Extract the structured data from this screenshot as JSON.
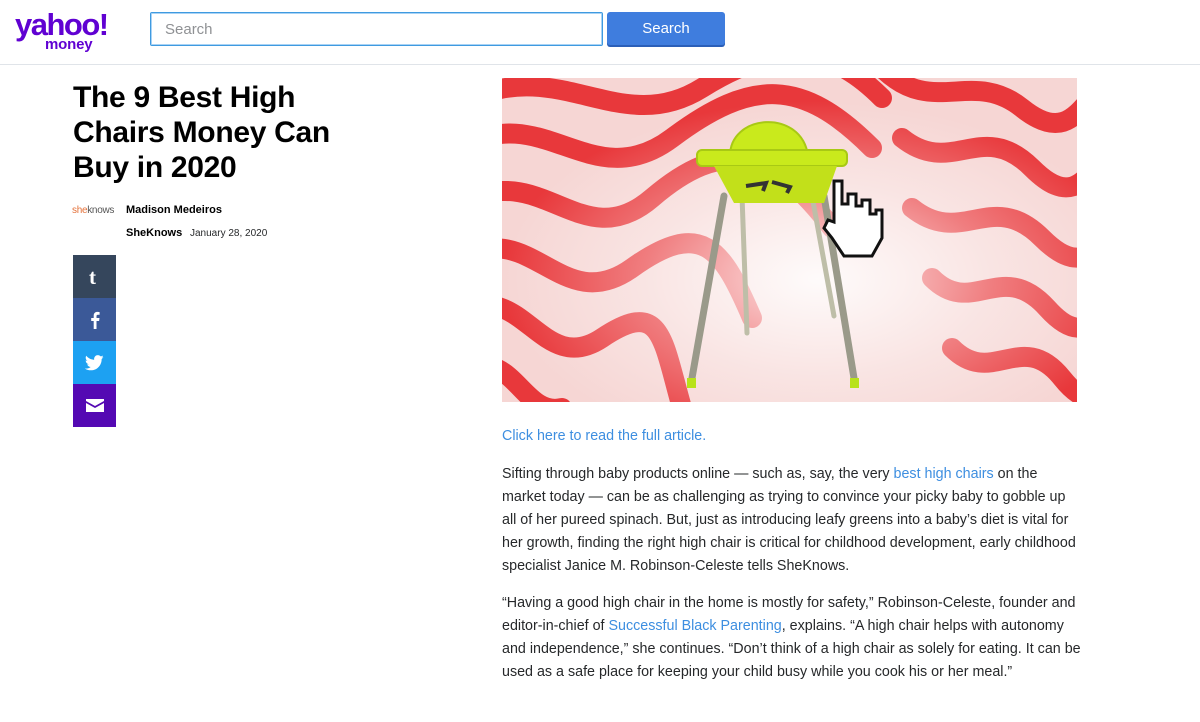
{
  "header": {
    "logo_primary": "yahoo!",
    "logo_secondary": "money",
    "search_placeholder": "Search",
    "search_value": "",
    "search_button": "Search",
    "brand_color": "#6001d2",
    "accent_color": "#3f7dde"
  },
  "article": {
    "title": "The 9 Best High Chairs Money Can Buy in 2020",
    "source_logo_a": "she",
    "source_logo_b": "knows",
    "author": "Madison Medeiros",
    "provider": "SheKnows",
    "date": "January 28, 2020",
    "read_full_link": "Click here to read the full article.",
    "p1_before": "Sifting through baby products online — such as, say, the very ",
    "p1_link": "best high chairs",
    "p1_after": " on the market today — can be as challenging as trying to convince your picky baby to gobble up all of her pureed spinach. But, just as introducing leafy greens into a baby’s diet is vital for her growth, finding the right high chair is critical for childhood development, early childhood specialist Janice M. Robinson-Celeste tells SheKnows.",
    "p2_before": "“Having a good high chair in the home is mostly for safety,” Robinson-Celeste, founder and editor-in-chief of ",
    "p2_link": "Successful Black Parenting",
    "p2_after": ", explains. “A high chair helps with autonomy and independence,” she continues. “Don’t think of a high chair as solely for eating. It can be used as a safe place for keeping your child busy while you cook his or her meal.”"
  },
  "share": {
    "items": [
      {
        "icon": "tumblr-icon",
        "color": "#35465c"
      },
      {
        "icon": "facebook-icon",
        "color": "#3b5998"
      },
      {
        "icon": "twitter-icon",
        "color": "#1da1f2"
      },
      {
        "icon": "email-icon",
        "color": "#5409b3"
      }
    ]
  }
}
